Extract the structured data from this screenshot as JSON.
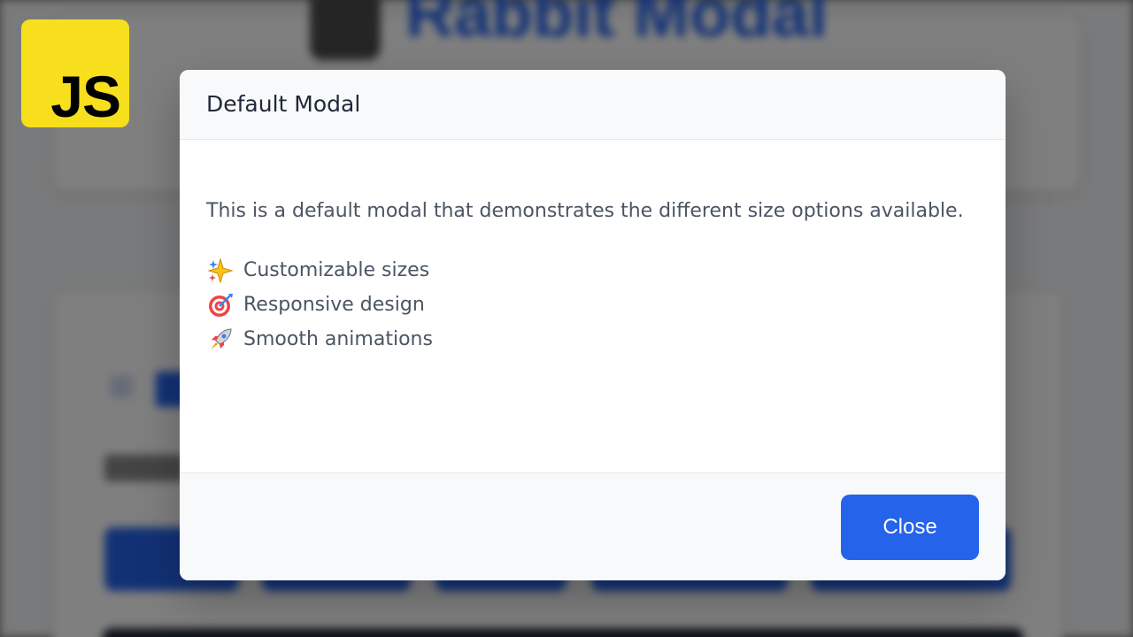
{
  "background": {
    "app_title": "Rabbit Modal"
  },
  "badge": {
    "label": "JS"
  },
  "modal": {
    "title": "Default Modal",
    "description": "This is a default modal that demonstrates the different size options available.",
    "features": [
      {
        "icon": "sparkles-icon",
        "label": "Customizable sizes"
      },
      {
        "icon": "target-icon",
        "label": "Responsive design"
      },
      {
        "icon": "rocket-icon",
        "label": "Smooth animations"
      }
    ],
    "close_label": "Close"
  },
  "colors": {
    "accent": "#2563eb",
    "js_yellow": "#f7df1e",
    "text_primary": "#1f2937",
    "text_secondary": "#4b5563"
  }
}
